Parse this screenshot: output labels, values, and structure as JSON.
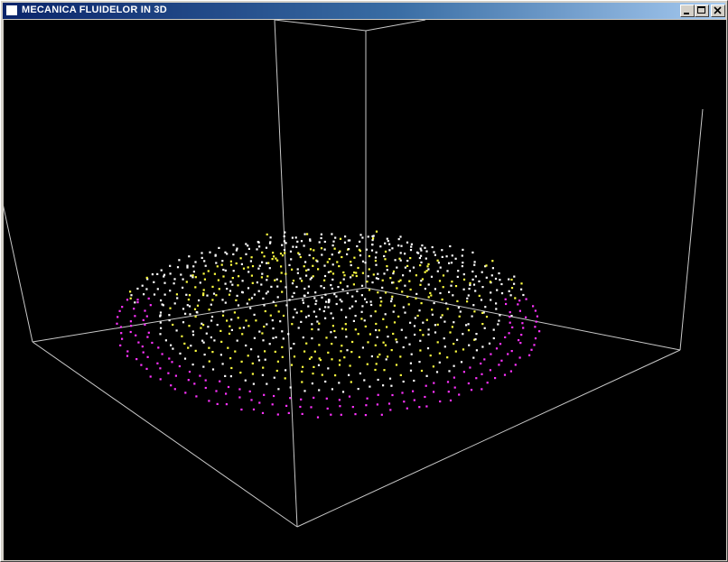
{
  "window": {
    "title": "MECANICA FLUIDELOR IN 3D",
    "controls": {
      "minimize": "minimize-icon",
      "maximize": "maximize-icon",
      "close": "close-icon"
    }
  },
  "scene": {
    "background": "#000000",
    "box_edge_color": "#c8c8c8",
    "particle_colors": {
      "top": "#ffffff",
      "middle": "#ffff40",
      "edge": "#ff33ff"
    }
  }
}
